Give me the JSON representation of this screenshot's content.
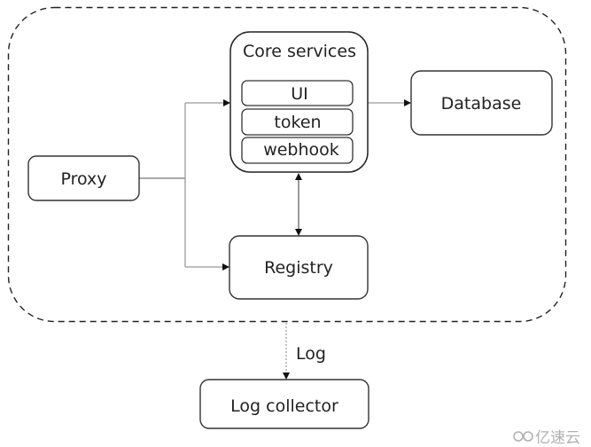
{
  "diagram": {
    "container": {
      "style": "dashed"
    },
    "nodes": {
      "proxy": {
        "label": "Proxy"
      },
      "core": {
        "label": "Core services",
        "children": [
          {
            "label": "UI"
          },
          {
            "label": "token"
          },
          {
            "label": "webhook"
          }
        ]
      },
      "database": {
        "label": "Database"
      },
      "registry": {
        "label": "Registry"
      },
      "log_collector": {
        "label": "Log collector"
      }
    },
    "edges": [
      {
        "from": "Proxy",
        "to": "Core services",
        "style": "solid"
      },
      {
        "from": "Proxy",
        "to": "Registry",
        "style": "solid"
      },
      {
        "from": "Core services",
        "to": "Database",
        "style": "solid"
      },
      {
        "from": "Core services",
        "to": "Registry",
        "style": "solid",
        "bidirectional": true
      },
      {
        "from": "container",
        "to": "Log collector",
        "style": "dotted",
        "label": "Log"
      }
    ],
    "edge_label_log": "Log"
  },
  "watermark": {
    "text": "亿速云"
  }
}
